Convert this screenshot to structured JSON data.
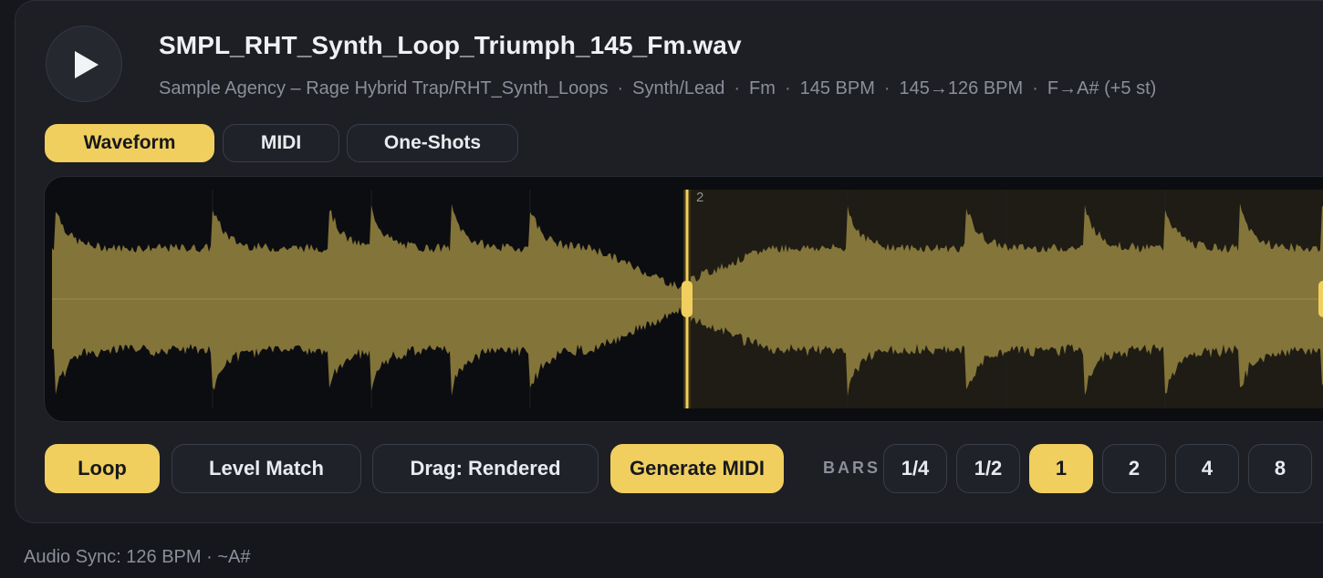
{
  "player": {
    "play_icon": "play-icon",
    "title": "SMPL_RHT_Synth_Loop_Triumph_145_Fm.wav",
    "meta": {
      "source": "Sample Agency – Rage Hybrid Trap/RHT_Synth_Loops",
      "category": "Synth/Lead",
      "key": "Fm",
      "bpm": "145 BPM",
      "bpm_sync": "145→126 BPM",
      "transpose": "F→A# (+5 st)",
      "separator": "·"
    }
  },
  "tabs": [
    {
      "label": "Waveform",
      "active": true
    },
    {
      "label": "MIDI",
      "active": false
    },
    {
      "label": "One-Shots",
      "active": false
    }
  ],
  "waveform": {
    "marker_label": "2",
    "accent_color": "#f0cf5e"
  },
  "controls": {
    "loop_label": "Loop",
    "level_match_label": "Level Match",
    "drag_label": "Drag: Rendered",
    "generate_midi_label": "Generate MIDI",
    "bars_label": "BARS",
    "bars_options": [
      {
        "label": "1/4",
        "active": false
      },
      {
        "label": "1/2",
        "active": false
      },
      {
        "label": "1",
        "active": true
      },
      {
        "label": "2",
        "active": false
      },
      {
        "label": "4",
        "active": false
      },
      {
        "label": "8",
        "active": false
      }
    ]
  },
  "footer": {
    "status": "Audio Sync: 126 BPM · ~A#"
  }
}
